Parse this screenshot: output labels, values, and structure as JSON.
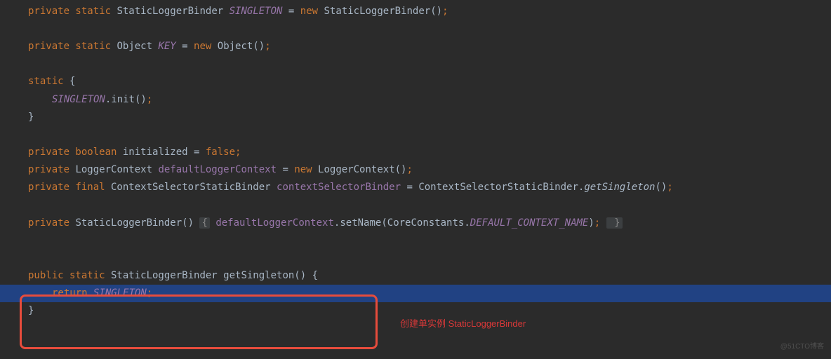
{
  "code": {
    "line1": {
      "kw1": "private static",
      "type": "StaticLoggerBinder",
      "field": "SINGLETON",
      "eq": " = ",
      "kw2": "new",
      "type2": " StaticLoggerBinder()",
      "semi": ";"
    },
    "line2": {
      "kw1": "private static",
      "type": " Object ",
      "field": "KEY",
      "eq": " = ",
      "kw2": "new",
      "type2": " Object()",
      "semi": ";"
    },
    "line3": {
      "kw": "static",
      "brace": " {"
    },
    "line4": {
      "field": "SINGLETON",
      "call": ".init()",
      "semi": ";"
    },
    "line5": {
      "brace": "}"
    },
    "line6": {
      "kw": "private boolean",
      "name": " initialized = ",
      "kw2": "false",
      "semi": ";"
    },
    "line7": {
      "kw": "private",
      "type": " LoggerContext ",
      "field": "defaultLoggerContext",
      "eq": " = ",
      "kw2": "new",
      "type2": " LoggerContext()",
      "semi": ";"
    },
    "line8": {
      "kw": "private final",
      "type": " ContextSelectorStaticBinder ",
      "field": "contextSelectorBinder",
      "eq": " = ContextSelectorStaticBinder.",
      "method": "getSingleton",
      "paren": "()",
      "semi": ";"
    },
    "line9": {
      "kw": "private",
      "type": " StaticLoggerBinder() ",
      "brace1": "{",
      "field": " defaultLoggerContext",
      "call": ".setName(CoreConstants.",
      "const": "DEFAULT_CONTEXT_NAME",
      "paren": ")",
      "semi": ";",
      "brace2": " }"
    },
    "line10": {
      "kw": "public static",
      "type": " StaticLoggerBinder getSingleton() {"
    },
    "line11": {
      "kw": "return",
      "field": " SINGLETON",
      "semi": ";"
    },
    "line12": {
      "brace": "}"
    }
  },
  "annotation": "创建单实例 StaticLoggerBinder",
  "watermark": "@51CTO博客"
}
